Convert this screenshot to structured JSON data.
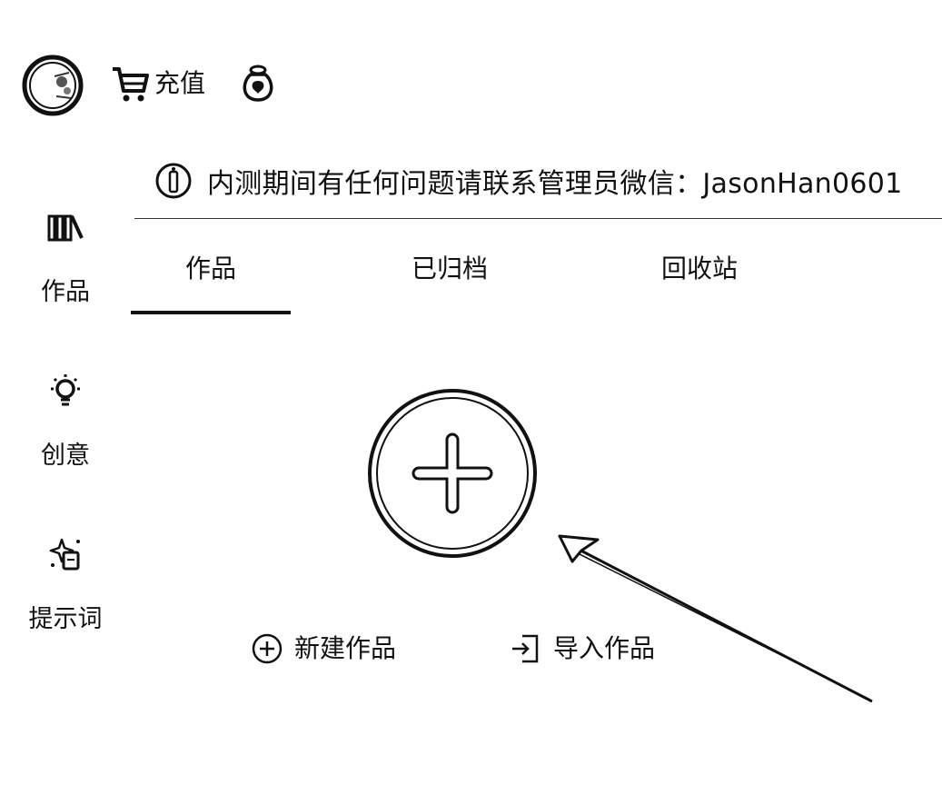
{
  "header": {
    "logo_icon": "moon-logo-icon",
    "recharge_icon": "cart-icon",
    "recharge_label": "充值",
    "wallet_icon": "money-bag-icon"
  },
  "notice": {
    "icon": "info-icon",
    "text": "内测期间有任何问题请联系管理员微信：JasonHan0601"
  },
  "sidebar": {
    "items": [
      {
        "icon": "library-icon",
        "label": "作品"
      },
      {
        "icon": "lightbulb-icon",
        "label": "创意"
      },
      {
        "icon": "sparkle-note-icon",
        "label": "提示词"
      }
    ]
  },
  "tabs": [
    {
      "label": "作品",
      "active": true
    },
    {
      "label": "已归档",
      "active": false
    },
    {
      "label": "回收站",
      "active": false
    }
  ],
  "main": {
    "big_add_icon": "plus-circle-icon",
    "actions": [
      {
        "icon": "plus-circle-icon",
        "label": "新建作品"
      },
      {
        "icon": "import-icon",
        "label": "导入作品"
      }
    ]
  }
}
